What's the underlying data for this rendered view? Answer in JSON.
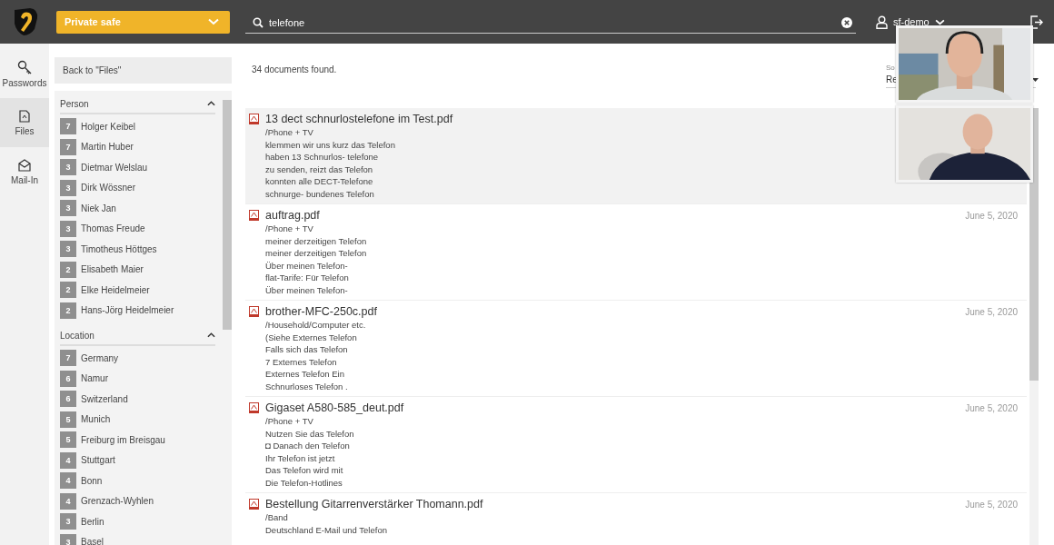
{
  "header": {
    "vault": "Private safe",
    "search": {
      "value": "telefone"
    },
    "user": "sf-demo"
  },
  "nav": [
    {
      "kind": "key",
      "label": "Passwords",
      "selected": false
    },
    {
      "kind": "file",
      "label": "Files",
      "selected": true
    },
    {
      "kind": "mail",
      "label": "Mail-In",
      "selected": false
    }
  ],
  "back": "Back to \"Files\"",
  "filters": [
    {
      "title": "Person",
      "expanded": true,
      "items": [
        {
          "count": "7",
          "name": "Holger Keibel"
        },
        {
          "count": "7",
          "name": "Martin Huber"
        },
        {
          "count": "3",
          "name": "Dietmar Welslau"
        },
        {
          "count": "3",
          "name": "Dirk Wössner"
        },
        {
          "count": "3",
          "name": "Niek Jan"
        },
        {
          "count": "3",
          "name": "Thomas Freude"
        },
        {
          "count": "3",
          "name": "Timotheus Höttges"
        },
        {
          "count": "2",
          "name": "Elisabeth Maier"
        },
        {
          "count": "2",
          "name": "Elke Heidelmeier"
        },
        {
          "count": "2",
          "name": "Hans-Jörg Heidelmeier"
        }
      ]
    },
    {
      "title": "Location",
      "expanded": true,
      "items": [
        {
          "count": "7",
          "name": "Germany"
        },
        {
          "count": "6",
          "name": "Namur"
        },
        {
          "count": "6",
          "name": "Switzerland"
        },
        {
          "count": "5",
          "name": "Munich"
        },
        {
          "count": "5",
          "name": "Freiburg im Breisgau"
        },
        {
          "count": "4",
          "name": "Stuttgart"
        },
        {
          "count": "4",
          "name": "Bonn"
        },
        {
          "count": "4",
          "name": "Grenzach-Wyhlen"
        },
        {
          "count": "3",
          "name": "Berlin"
        },
        {
          "count": "3",
          "name": "Basel"
        }
      ]
    }
  ],
  "found": "34 documents found.",
  "sort": {
    "label": "So",
    "value": "Re"
  },
  "results": [
    {
      "title": "13 dect schnurlostelefone im Test.pdf",
      "folder": "/Phone + TV",
      "selected": true,
      "snippets": [
        "klemmen wir uns kurz das Telefon",
        "haben 13 Schnurlos- telefone",
        "zu senden, reizt das Telefon",
        "konnten alle DECT-Telefone",
        "schnurge- bundenes Telefon"
      ]
    },
    {
      "title": "auftrag.pdf",
      "folder": "/Phone + TV",
      "date": "June 5, 2020",
      "selected": false,
      "snippets": [
        "meiner derzeitigen Telefon",
        "meiner derzeitigen Telefon",
        "Über meinen Telefon-",
        "flat-Tarife: Für Telefon",
        "Über meinen Telefon-"
      ]
    },
    {
      "title": "brother-MFC-250c.pdf",
      "folder": "/Household/Computer etc.",
      "date": "June 5, 2020",
      "selected": false,
      "snippets": [
        "(Siehe Externes Telefon",
        "Falls sich das Telefon",
        "7 Externes Telefon",
        "Externes Telefon Ein",
        "Schnurloses Telefon ."
      ]
    },
    {
      "title": "Gigaset A580-585_deut.pdf",
      "folder": "/Phone + TV",
      "date": "June 5, 2020",
      "selected": false,
      "snippets": [
        "Nutzen Sie das Telefon",
        "◘ Danach den Telefon",
        "Ihr Telefon ist jetzt",
        "Das Telefon wird mit",
        "Die Telefon-Hotlines"
      ]
    },
    {
      "title": "Bestellung Gitarrenverstärker Thomann.pdf",
      "folder": "/Band",
      "date": "June 5, 2020",
      "selected": false,
      "snippets": [
        "Deutschland E-Mail und Telefon"
      ]
    }
  ]
}
